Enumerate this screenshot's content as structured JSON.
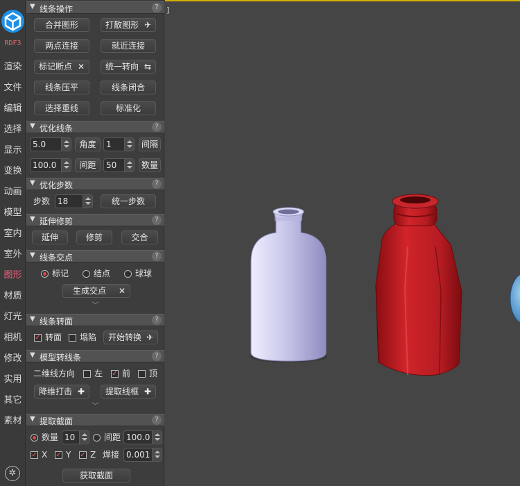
{
  "sidebar": {
    "brand": "RDF3",
    "items": [
      "渲染",
      "文件",
      "编辑",
      "选择",
      "显示",
      "变换",
      "动画",
      "模型",
      "室内",
      "室外",
      "图形",
      "材质",
      "灯光",
      "相机",
      "修改",
      "实用",
      "其它",
      "素材"
    ],
    "active": "图形",
    "settings_icon": "gear-icon"
  },
  "sections": {
    "line_ops": {
      "title": "线条操作",
      "buttons": [
        "合并图形",
        "打散图形",
        "两点连接",
        "就近连接",
        "标记断点",
        "统一转向",
        "线条压平",
        "线条闭合",
        "选择重线",
        "标准化"
      ]
    },
    "optimize": {
      "title": "优化线条",
      "angle_value": "5.0",
      "angle_label": "角度",
      "interval_value": "1",
      "interval_label": "间隔",
      "spacing_value": "100.0",
      "spacing_label": "间距",
      "count_value": "50",
      "count_label": "数量"
    },
    "opt_steps": {
      "title": "优化步数",
      "steps_label": "步数",
      "steps_value": "18",
      "unify_button": "统一步数"
    },
    "extend_trim": {
      "title": "延伸修剪",
      "buttons": [
        "延伸",
        "修剪",
        "交合"
      ]
    },
    "intersect": {
      "title": "线条交点",
      "radios": [
        "标记",
        "结点",
        "球球"
      ],
      "selected": "标记",
      "generate_button": "生成交点"
    },
    "turn_face": {
      "title": "线条转面",
      "face_label": "转面",
      "face_checked": true,
      "collapse_label": "塌陷",
      "collapse_checked": false,
      "start_button": "开始转换"
    },
    "model_to_line": {
      "title": "模型转线条",
      "dir_label": "二维线方向",
      "left_label": "左",
      "left_checked": false,
      "front_label": "前",
      "front_checked": true,
      "top_label": "顶",
      "top_checked": false,
      "reduce_button": "降维打击",
      "extract_button": "提取线框"
    },
    "extract_section": {
      "title": "提取截面",
      "count_label": "数量",
      "count_value": "10",
      "count_selected": true,
      "spacing_label": "间距",
      "spacing_value": "100.0",
      "x_label": "X",
      "y_label": "Y",
      "z_label": "Z",
      "weld_label": "焊接",
      "weld_value": "0.001",
      "get_button": "获取截面"
    }
  },
  "viewport": {
    "corner_label": "]"
  },
  "colors": {
    "accent_red": "#e04848",
    "logo_blue": "#1e90e6",
    "bottle_white": "#c9c8ea",
    "bottle_red": "#c41d24",
    "viewport_top": "#d4b000"
  }
}
